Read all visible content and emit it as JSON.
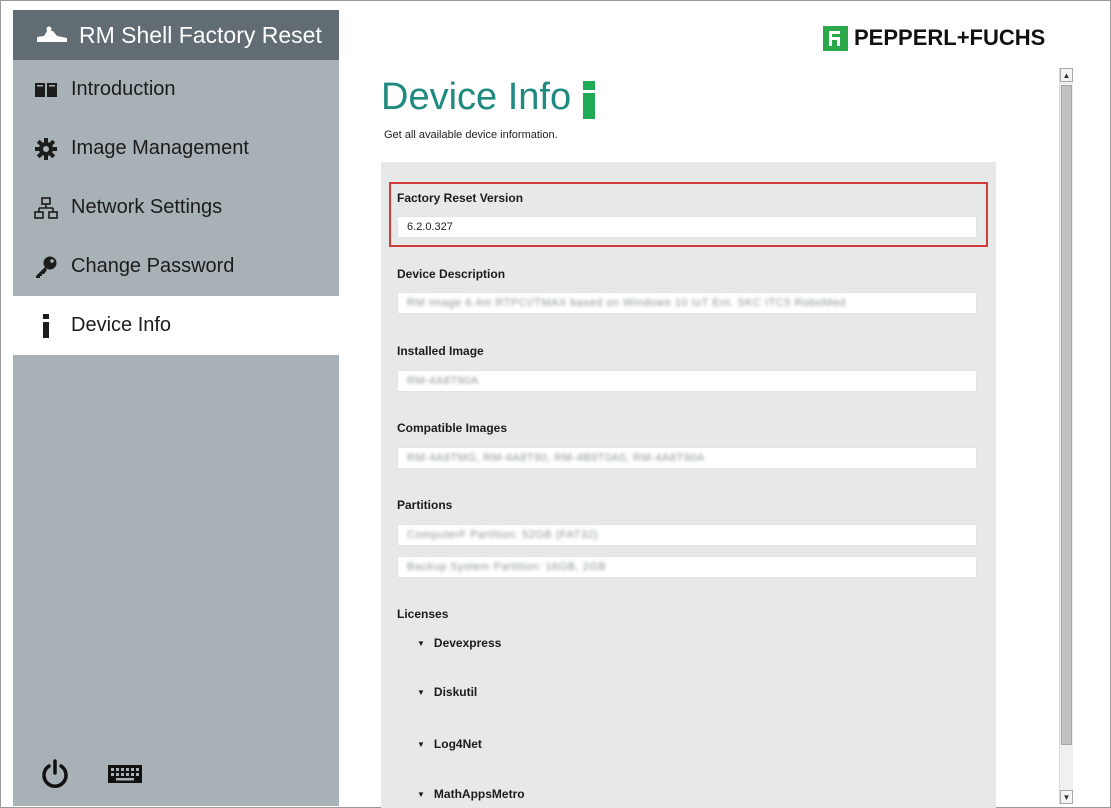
{
  "app": {
    "title": "RM Shell Factory Reset",
    "brand": "PEPPERL+FUCHS"
  },
  "sidebar": {
    "items": [
      {
        "label": "Introduction",
        "icon": "book-icon"
      },
      {
        "label": "Image Management",
        "icon": "gear-icon"
      },
      {
        "label": "Network Settings",
        "icon": "network-icon"
      },
      {
        "label": "Change Password",
        "icon": "key-icon"
      },
      {
        "label": "Device Info",
        "icon": "info-icon",
        "active": true
      }
    ],
    "bottom_icons": [
      "power-icon",
      "keyboard-icon"
    ]
  },
  "main": {
    "title": "Device Info",
    "subtitle": "Get all available device information.",
    "fields": {
      "factory_reset_version": {
        "label": "Factory Reset Version",
        "value": "6.2.0.327"
      },
      "device_description": {
        "label": "Device Description",
        "value": "RM Image 6.4m RTPCI/TMAX based on Windows 10 IoT Ent. SKC ITC5 RoboMed"
      },
      "installed_image": {
        "label": "Installed Image",
        "value": "RM-4A8T90A"
      },
      "compatible_images": {
        "label": "Compatible Images",
        "value": "RM-4A8TMG, RM-4A8T90, RM-4B9T0A0, RM-4A8T90A"
      },
      "partitions": {
        "label": "Partitions",
        "values": [
          "ComputerF Partition: 52GB (FAT32)",
          "Backup System Partition: 16GB, 2GB"
        ]
      }
    },
    "licenses": {
      "label": "Licenses",
      "items": [
        "Devexpress",
        "Diskutil",
        "Log4Net",
        "MathAppsMetro"
      ]
    }
  },
  "colors": {
    "sidebar_header": "#616d72",
    "sidebar_bg": "#a7b1b6",
    "accent": "#1f8a80",
    "brand_green": "#2aa84a",
    "highlight": "#d23b3b"
  }
}
